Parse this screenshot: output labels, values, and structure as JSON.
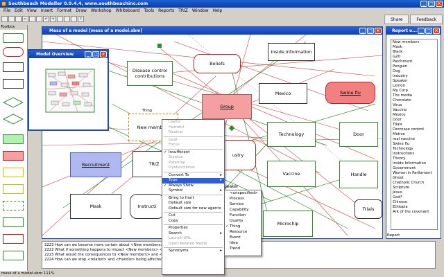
{
  "app": {
    "title": "Southbeach Modeller 0.9.4.4, www.southbeachinc.com"
  },
  "menu": [
    "File",
    "Edit",
    "View",
    "Insert",
    "Format",
    "Draw",
    "Workshop",
    "Whiteboard",
    "Tools",
    "Reports",
    "TRIZ",
    "Window",
    "Help"
  ],
  "share": {
    "share_label": "Share",
    "feedback_label": "Feedback"
  },
  "toolbox": {
    "title": "Toolbox"
  },
  "doc": {
    "title": "Mess of a model [mess of a model.sbm]",
    "nodes": {
      "beliefs": "Beliefs",
      "inside_information": "Inside Information",
      "disease_control": "Disease control contributions",
      "mexico": "Mexico",
      "swine_flu": "Swine flu",
      "group": "Group",
      "new_members": "New members",
      "technology": "Technology",
      "door": "Door",
      "industry": "ustry",
      "recruitment": "Recruitment",
      "triz": "TRIZ",
      "vaccine": "Vaccine",
      "handle": "Handle",
      "mask": "Mask",
      "instruction": "Instructi",
      "speaker": "peaker",
      "trials": "Trials",
      "microchip": "Microchip",
      "thing": "Thing"
    }
  },
  "overview": {
    "title": "Model Overview"
  },
  "report": {
    "title": "Report o...",
    "footer": "Report",
    "items": [
      "New members",
      "Mask",
      "Black",
      "G20",
      "Parchment",
      "Penguin",
      "Dog",
      "Industry",
      "Speaker",
      "Lemon",
      "My Corp",
      "The media",
      "Chocolate",
      "Virus",
      "Vaccine",
      "Mexico",
      "Door",
      "Trials",
      "Decrease control",
      "Motive",
      "real vaccine",
      "Swine flu",
      "Technology",
      "Instructions",
      "Theory",
      "Inside Information",
      "Government",
      "Women in Parliament",
      "Ghost",
      "Chatholic Church",
      "Scripture",
      "Jesus",
      "God?",
      "Chinese",
      "Ethiopia",
      "Ark of the covenant"
    ]
  },
  "context_menu": {
    "items": [
      {
        "label": "Useful",
        "type": "dis"
      },
      {
        "label": "Harmful",
        "type": "dis"
      },
      {
        "label": "Neutral",
        "type": "dis"
      },
      {
        "sep": true
      },
      {
        "label": "Goal",
        "type": "dis"
      },
      {
        "label": "Focus",
        "type": "dis"
      },
      {
        "sep": true
      },
      {
        "label": "Insufficient",
        "type": "chk"
      },
      {
        "label": "Surplus",
        "type": "dis"
      },
      {
        "label": "Potential",
        "type": "dis"
      },
      {
        "label": "Dysfunctional",
        "type": "dis"
      },
      {
        "sep": true
      },
      {
        "label": "Convert To",
        "type": "sub"
      },
      {
        "label": "Type",
        "type": "hl"
      },
      {
        "label": "Always Show",
        "type": "chk"
      },
      {
        "label": "Symbol",
        "type": "sub"
      },
      {
        "sep": true
      },
      {
        "label": "Bring to front",
        "type": ""
      },
      {
        "label": "Default size",
        "type": ""
      },
      {
        "label": "Default size for new agents",
        "type": ""
      },
      {
        "sep": true
      },
      {
        "label": "Cut",
        "type": ""
      },
      {
        "label": "Copy",
        "type": ""
      },
      {
        "sep": true
      },
      {
        "label": "Properties",
        "type": ""
      },
      {
        "label": "Search",
        "type": "sub"
      },
      {
        "label": "Launch URL",
        "type": "dis"
      },
      {
        "label": "Open Related Model",
        "type": "dis"
      },
      {
        "sep": true
      },
      {
        "label": "Synonyms",
        "type": "sub"
      }
    ]
  },
  "type_submenu": {
    "items": [
      {
        "label": "<unspecified>",
        "checked": false
      },
      {
        "label": "Process",
        "checked": false
      },
      {
        "label": "Service",
        "checked": false
      },
      {
        "label": "Capability",
        "checked": false
      },
      {
        "label": "Function",
        "checked": false
      },
      {
        "label": "Quality",
        "checked": false
      },
      {
        "label": "Thing",
        "checked": true
      },
      {
        "label": "Resource",
        "checked": false
      },
      {
        "label": "Event",
        "checked": false
      },
      {
        "label": "Idea",
        "checked": false
      },
      {
        "label": "Trend",
        "checked": false
      }
    ]
  },
  "bottom_panel": {
    "lines": [
      "2223 How can we become more certain about <New members> <related> ...",
      "2222 What if something happens to impact <New members> <related> ...",
      "2223 What would the consequences to <New members> and <related> ...",
      "2224 How can we stop <related> and <Handle> being affected?"
    ]
  },
  "status": {
    "text": "mess of a model.sbm 111%"
  }
}
